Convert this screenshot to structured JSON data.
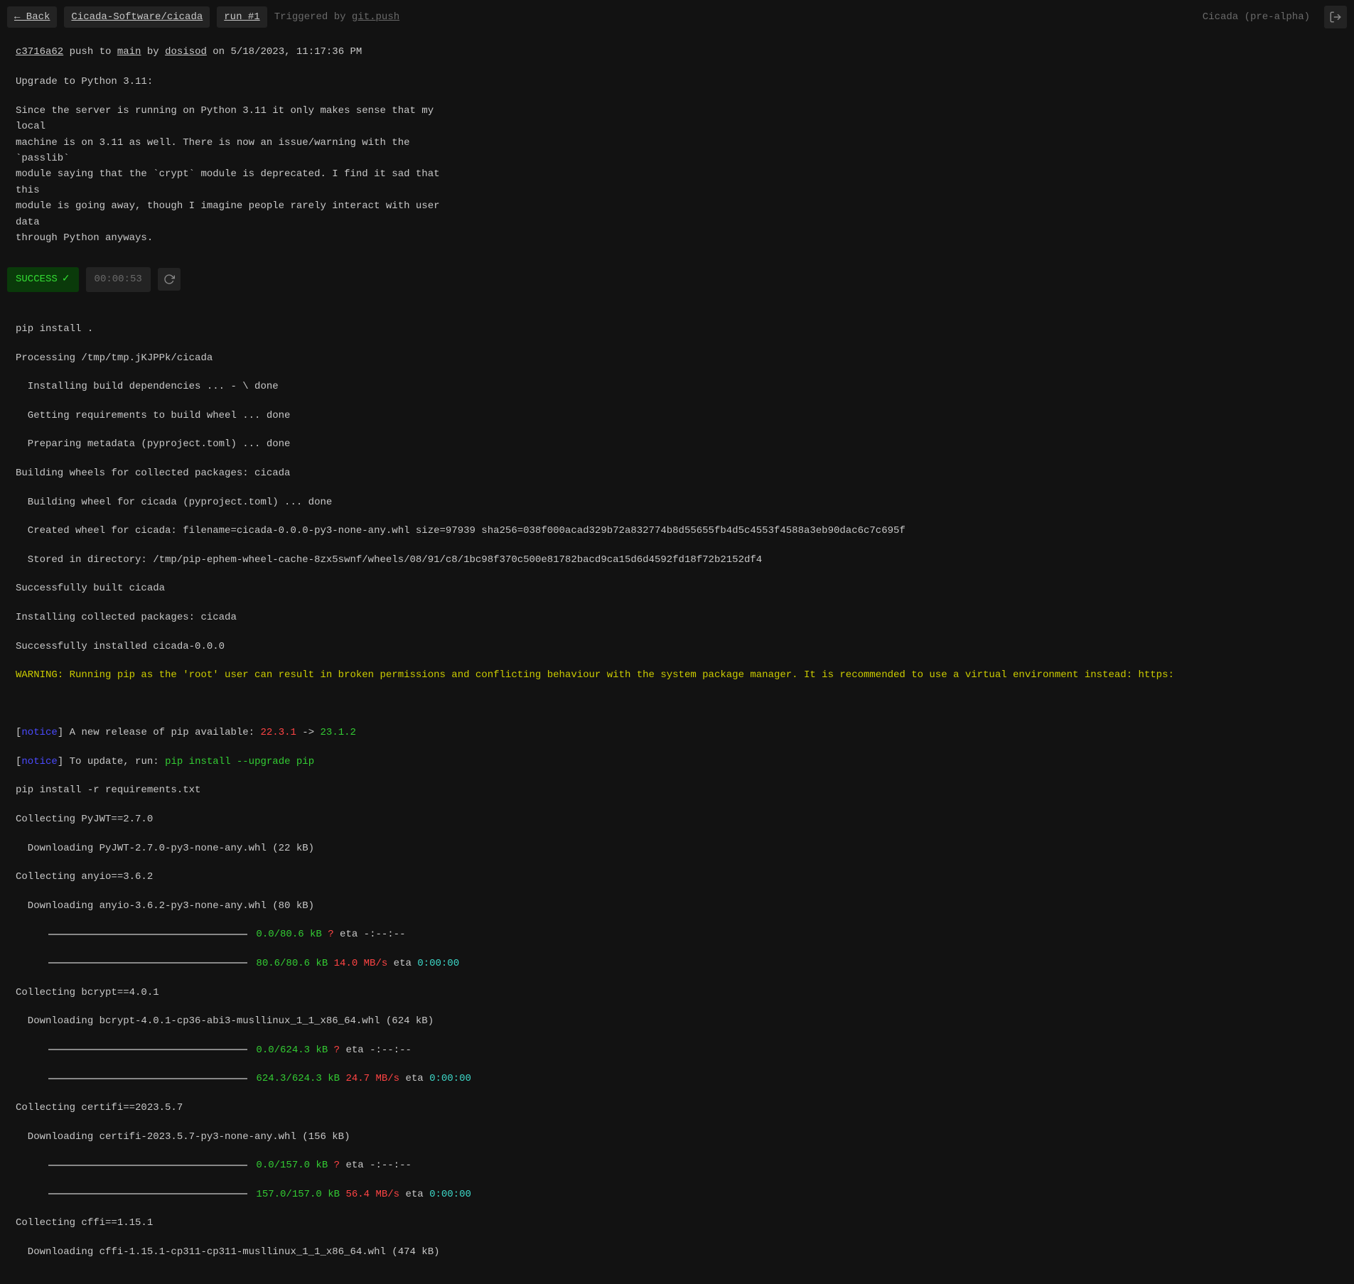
{
  "topbar": {
    "back_label": "← Back",
    "repo_link": "Cicada-Software/cicada",
    "run_label": "run #1",
    "trigger_prefix": "Triggered by ",
    "trigger_event": "git.push",
    "brand": "Cicada (pre-alpha)"
  },
  "commit": {
    "hash": "c3716a62",
    "action": " push to ",
    "branch": "main",
    "by": " by ",
    "author": "dosisod",
    "date": " on 5/18/2023, 11:17:36 PM",
    "title": "Upgrade to Python 3.11:",
    "body": "Since the server is running on Python 3.11 it only makes sense that my local\nmachine is on 3.11 as well. There is now an issue/warning with the `passlib`\nmodule saying that the `crypt` module is deprecated. I find it sad that this\nmodule is going away, though I imagine people rarely interact with user data\nthrough Python anyways."
  },
  "status": {
    "label": "SUCCESS",
    "duration": "00:00:53"
  },
  "log": {
    "l01": "pip install .",
    "l02": "Processing /tmp/tmp.jKJPPk/cicada",
    "l03": "  Installing build dependencies ... - \\ done",
    "l04": "  Getting requirements to build wheel ... done",
    "l05": "  Preparing metadata (pyproject.toml) ... done",
    "l06": "Building wheels for collected packages: cicada",
    "l07": "  Building wheel for cicada (pyproject.toml) ... done",
    "l08": "  Created wheel for cicada: filename=cicada-0.0.0-py3-none-any.whl size=97939 sha256=038f000acad329b72a832774b8d55655fb4d5c4553f4588a3eb90dac6c7c695f",
    "l09": "  Stored in directory: /tmp/pip-ephem-wheel-cache-8zx5swnf/wheels/08/91/c8/1bc98f370c500e81782bacd9ca15d6d4592fd18f72b2152df4",
    "l10": "Successfully built cicada",
    "l11": "Installing collected packages: cicada",
    "l12": "Successfully installed cicada-0.0.0",
    "l13": "WARNING: Running pip as the 'root' user can result in broken permissions and conflicting behaviour with the system package manager. It is recommended to use a virtual environment instead: https:",
    "notice_open": "[",
    "notice_word": "notice",
    "notice_close": "] ",
    "l14a": "A new release of pip available: ",
    "l14_old": "22.3.1",
    "l14_arrow": " -> ",
    "l14_new": "23.1.2",
    "l15a": "To update, run: ",
    "l15_cmd": "pip install --upgrade pip",
    "l16": "pip install -r requirements.txt",
    "l17": "Collecting PyJWT==2.7.0",
    "l18": "  Downloading PyJWT-2.7.0-py3-none-any.whl (22 kB)",
    "l19": "Collecting anyio==3.6.2",
    "l20": "  Downloading anyio-3.6.2-py3-none-any.whl (80 kB)",
    "p1a_size": "0.0/80.6 kB",
    "p1a_q": " ?",
    "p1a_eta": " eta ",
    "p1a_time": "-:--:--",
    "p1b_size": "80.6/80.6 kB",
    "p1b_speed": " 14.0 MB/s",
    "p1b_eta": " eta ",
    "p1b_time": "0:00:00",
    "l21": "Collecting bcrypt==4.0.1",
    "l22": "  Downloading bcrypt-4.0.1-cp36-abi3-musllinux_1_1_x86_64.whl (624 kB)",
    "p2a_size": "0.0/624.3 kB",
    "p2a_q": " ?",
    "p2b_size": "624.3/624.3 kB",
    "p2b_speed": " 24.7 MB/s",
    "l23": "Collecting certifi==2023.5.7",
    "l24": "  Downloading certifi-2023.5.7-py3-none-any.whl (156 kB)",
    "p3a_size": "0.0/157.0 kB",
    "p3a_q": " ?",
    "p3b_size": "157.0/157.0 kB",
    "p3b_speed": " 56.4 MB/s",
    "l25": "Collecting cffi==1.15.1",
    "l26": "  Downloading cffi-1.15.1-cp311-cp311-musllinux_1_1_x86_64.whl (474 kB)",
    "pad": "     "
  }
}
